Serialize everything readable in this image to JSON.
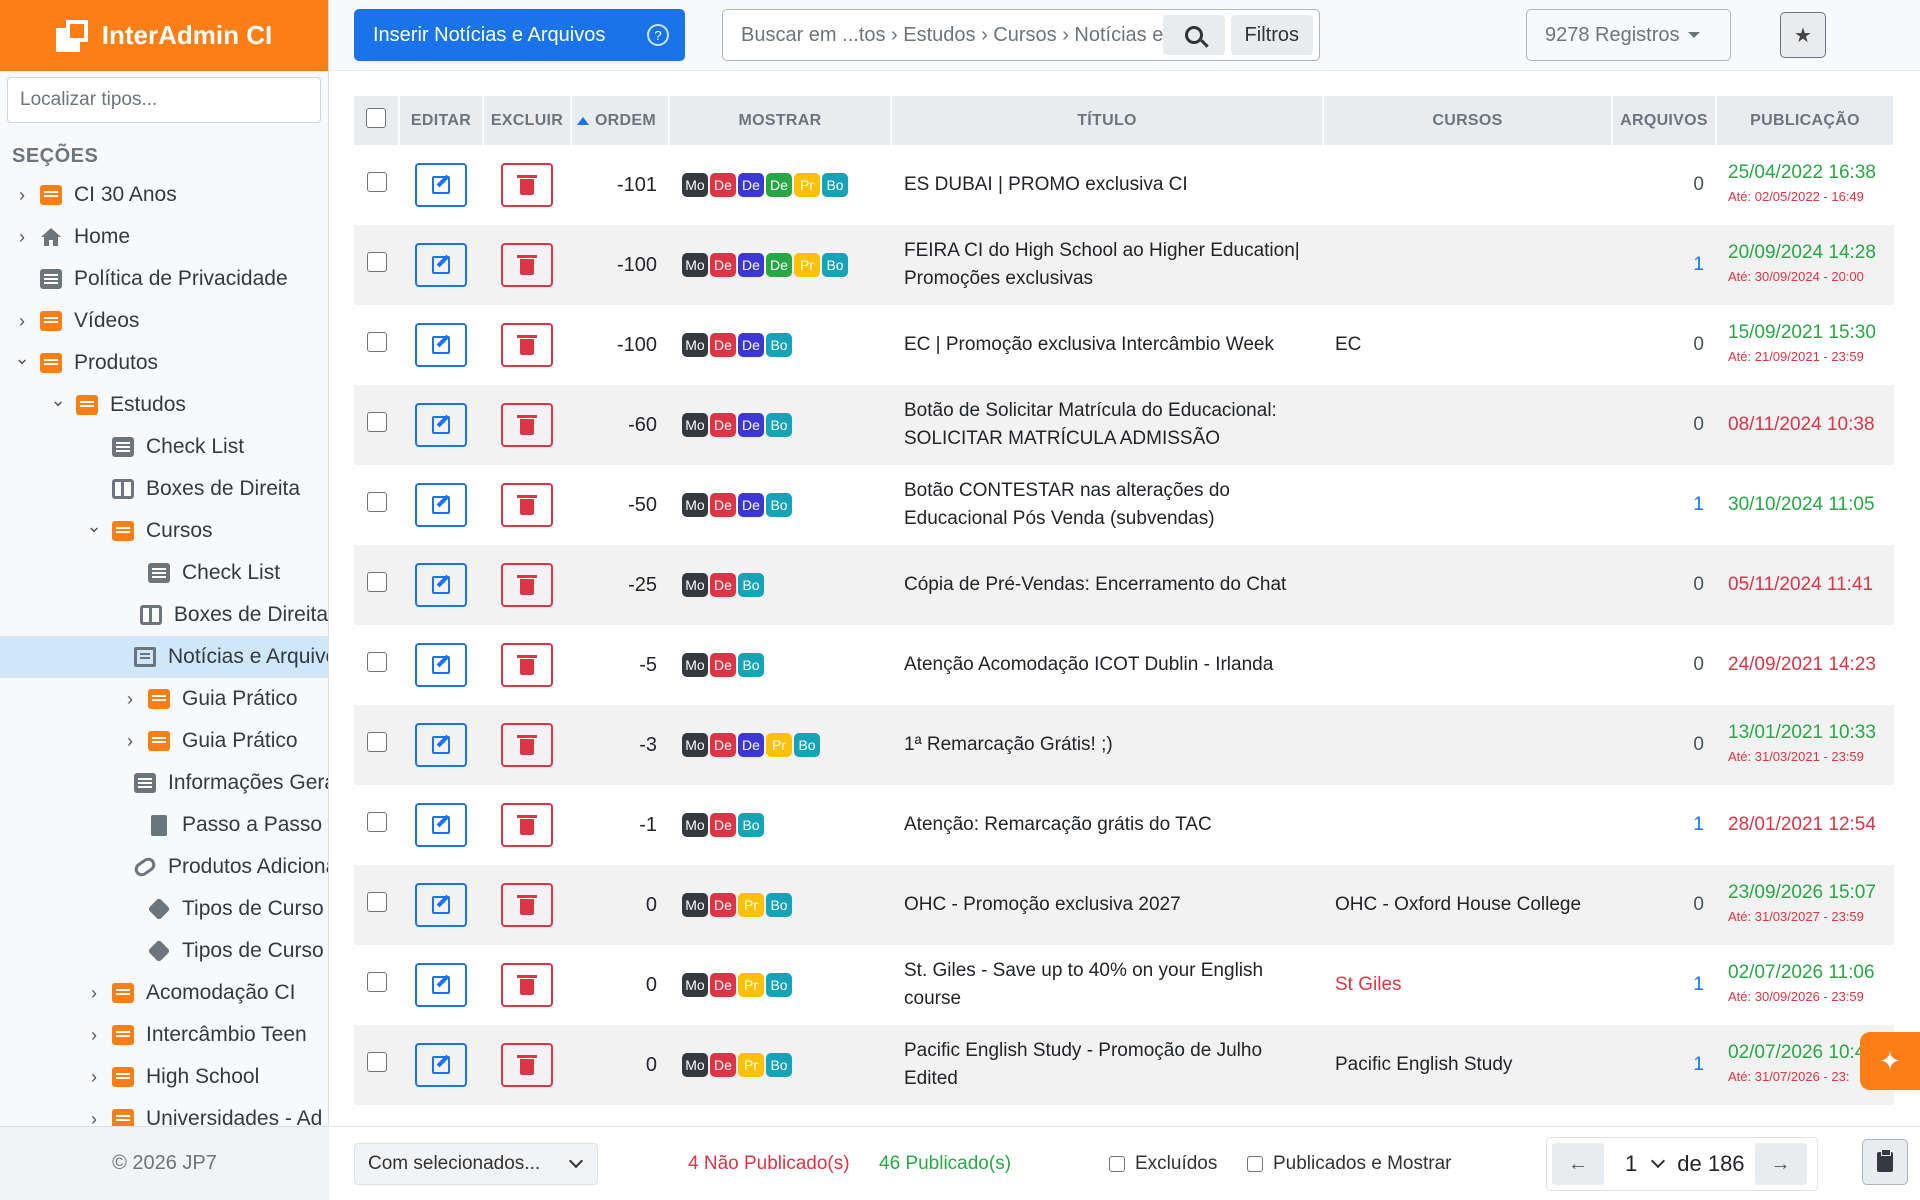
{
  "app": {
    "title": "InterAdmin CI"
  },
  "sidebar": {
    "search_placeholder": "Localizar tipos...",
    "sections_title": "SEÇÕES",
    "items": [
      {
        "label": "CI 30 Anos",
        "depth": 0,
        "chevron": "right",
        "icon": "folder-icon"
      },
      {
        "label": "Home",
        "depth": 0,
        "chevron": "right",
        "icon": "home-icon"
      },
      {
        "label": "Política de Privacidade",
        "depth": 0,
        "chevron": "none",
        "icon": "list-icon"
      },
      {
        "label": "Vídeos",
        "depth": 0,
        "chevron": "right",
        "icon": "folder-icon"
      },
      {
        "label": "Produtos",
        "depth": 0,
        "chevron": "down",
        "icon": "folder-icon"
      },
      {
        "label": "Estudos",
        "depth": 1,
        "chevron": "down",
        "icon": "folder-icon"
      },
      {
        "label": "Check List",
        "depth": 2,
        "chevron": "none",
        "icon": "list-icon"
      },
      {
        "label": "Boxes de Direita",
        "depth": 2,
        "chevron": "none",
        "icon": "columns-icon"
      },
      {
        "label": "Cursos",
        "depth": 2,
        "chevron": "down",
        "icon": "folder-icon"
      },
      {
        "label": "Check List",
        "depth": 3,
        "chevron": "none",
        "icon": "list-icon"
      },
      {
        "label": "Boxes de Direita",
        "depth": 3,
        "chevron": "none",
        "icon": "columns-icon"
      },
      {
        "label": "Notícias e Arquivos",
        "depth": 3,
        "chevron": "none",
        "icon": "newspaper-icon",
        "active": true
      },
      {
        "label": "Guia Prático",
        "depth": 3,
        "chevron": "right",
        "icon": "folder-icon"
      },
      {
        "label": "Guia Prático",
        "depth": 3,
        "chevron": "right",
        "icon": "folder-icon"
      },
      {
        "label": "Informações Gerais",
        "depth": 3,
        "chevron": "none",
        "icon": "list-icon"
      },
      {
        "label": "Passo a Passo",
        "depth": 3,
        "chevron": "none",
        "icon": "document-icon"
      },
      {
        "label": "Produtos Adicionais",
        "depth": 3,
        "chevron": "none",
        "icon": "link-icon"
      },
      {
        "label": "Tipos de Curso",
        "depth": 3,
        "chevron": "none",
        "icon": "tag-icon"
      },
      {
        "label": "Tipos de Curso",
        "depth": 3,
        "chevron": "none",
        "icon": "tag-icon"
      },
      {
        "label": "Acomodação CI",
        "depth": 2,
        "chevron": "right",
        "icon": "folder-icon"
      },
      {
        "label": "Intercâmbio Teen",
        "depth": 2,
        "chevron": "right",
        "icon": "folder-icon"
      },
      {
        "label": "High School",
        "depth": 2,
        "chevron": "right",
        "icon": "folder-icon"
      },
      {
        "label": "Universidades - Ad",
        "depth": 2,
        "chevron": "right",
        "icon": "folder-icon"
      }
    ],
    "footer": "© 2026 JP7"
  },
  "toolbar": {
    "insert_label": "Inserir Notícias e Arquivos",
    "search_text": "Buscar em  ...tos › Estudos › Cursos › Notícias e Arquivos",
    "filter_label": "Filtros",
    "records_label": "9278 Registros"
  },
  "table": {
    "headers": {
      "edit": "EDITAR",
      "delete": "EXCLUIR",
      "order": "ORDEM",
      "show": "MOSTRAR",
      "title": "TÍTULO",
      "courses": "CURSOS",
      "files": "ARQUIVOS",
      "publication": "PUBLICAÇÃO"
    },
    "rows": [
      {
        "order": "-101",
        "tags": [
          "Mo",
          "De",
          "De",
          "De",
          "Pr",
          "Bo"
        ],
        "title": "ES DUBAI | PROMO exclusiva CI",
        "course": "",
        "files": "0",
        "date": "25/04/2022 16:38",
        "date_color": "#28a745",
        "until": "Até: 02/05/2022 - 16:49"
      },
      {
        "order": "-100",
        "tags": [
          "Mo",
          "De",
          "De",
          "De",
          "Pr",
          "Bo"
        ],
        "title": "FEIRA CI do High School ao Higher Education| Promoções exclusivas",
        "course": "",
        "files": "1",
        "date": "20/09/2024 14:28",
        "date_color": "#28a745",
        "until": "Até: 30/09/2024 - 20:00"
      },
      {
        "order": "-100",
        "tags": [
          "Mo",
          "De",
          "De",
          "Bo"
        ],
        "title": "EC | Promoção exclusiva Intercâmbio Week",
        "course": "EC",
        "files": "0",
        "date": "15/09/2021 15:30",
        "date_color": "#28a745",
        "until": "Até: 21/09/2021 - 23:59"
      },
      {
        "order": "-60",
        "tags": [
          "Mo",
          "De",
          "De",
          "Bo"
        ],
        "title": "Botão de Solicitar Matrícula do Educacional: SOLICITAR MATRÍCULA ADMISSÃO",
        "course": "",
        "files": "0",
        "date": "08/11/2024 10:38",
        "date_color": "#dc3545",
        "until": ""
      },
      {
        "order": "-50",
        "tags": [
          "Mo",
          "De",
          "De",
          "Bo"
        ],
        "title": "Botão CONTESTAR nas alterações do Educacional Pós Venda (subvendas)",
        "course": "",
        "files": "1",
        "date": "30/10/2024 11:05",
        "date_color": "#28a745",
        "until": ""
      },
      {
        "order": "-25",
        "tags": [
          "Mo",
          "De",
          "Bo"
        ],
        "title": "Cópia de Pré-Vendas: Encerramento do Chat",
        "course": "",
        "files": "0",
        "date": "05/11/2024 11:41",
        "date_color": "#dc3545",
        "until": ""
      },
      {
        "order": "-5",
        "tags": [
          "Mo",
          "De",
          "Bo"
        ],
        "title": "Atenção Acomodação ICOT Dublin - Irlanda",
        "course": "",
        "files": "0",
        "date": "24/09/2021 14:23",
        "date_color": "#dc3545",
        "until": ""
      },
      {
        "order": "-3",
        "tags": [
          "Mo",
          "De",
          "De",
          "Pr",
          "Bo"
        ],
        "title": "1ª Remarcação Grátis! ;)",
        "course": "",
        "files": "0",
        "date": "13/01/2021 10:33",
        "date_color": "#28a745",
        "until": "Até: 31/03/2021 - 23:59"
      },
      {
        "order": "-1",
        "tags": [
          "Mo",
          "De",
          "Bo"
        ],
        "title": "Atenção: Remarcação grátis do TAC",
        "course": "",
        "files": "1",
        "date": "28/01/2021 12:54",
        "date_color": "#dc3545",
        "until": ""
      },
      {
        "order": "0",
        "tags": [
          "Mo",
          "De",
          "Pr",
          "Bo"
        ],
        "title": "OHC - Promoção exclusiva 2027",
        "course": "OHC - Oxford House College",
        "files": "0",
        "date": "23/09/2026 15:07",
        "date_color": "#28a745",
        "until": "Até: 31/03/2027 - 23:59"
      },
      {
        "order": "0",
        "tags": [
          "Mo",
          "De",
          "Pr",
          "Bo"
        ],
        "title": "St. Giles - Save up to 40% on your English course",
        "course": "St Giles",
        "course_color": "#dc3545",
        "files": "1",
        "date": "02/07/2026 11:06",
        "date_color": "#28a745",
        "until": "Até: 30/09/2026 - 23:59"
      },
      {
        "order": "0",
        "tags": [
          "Mo",
          "De",
          "Pr",
          "Bo"
        ],
        "title": "Pacific English Study - Promoção de Julho Edited",
        "course": "Pacific English Study",
        "files": "1",
        "date": "02/07/2026 10:4",
        "date_color": "#28a745",
        "until": "Até: 31/07/2026 - 23:"
      }
    ]
  },
  "bottom": {
    "with_selected": "Com selecionados...",
    "unpublished": "4 Não Publicado(s)",
    "published": "46 Publicado(s)",
    "excluded": "Excluídos",
    "published_and_show": "Publicados e Mostrar",
    "page": "1",
    "of_pages": "de 186"
  },
  "colors": {
    "brand": "#fd7e14",
    "primary": "#1a73e8",
    "danger": "#dc3545",
    "success": "#28a745"
  }
}
